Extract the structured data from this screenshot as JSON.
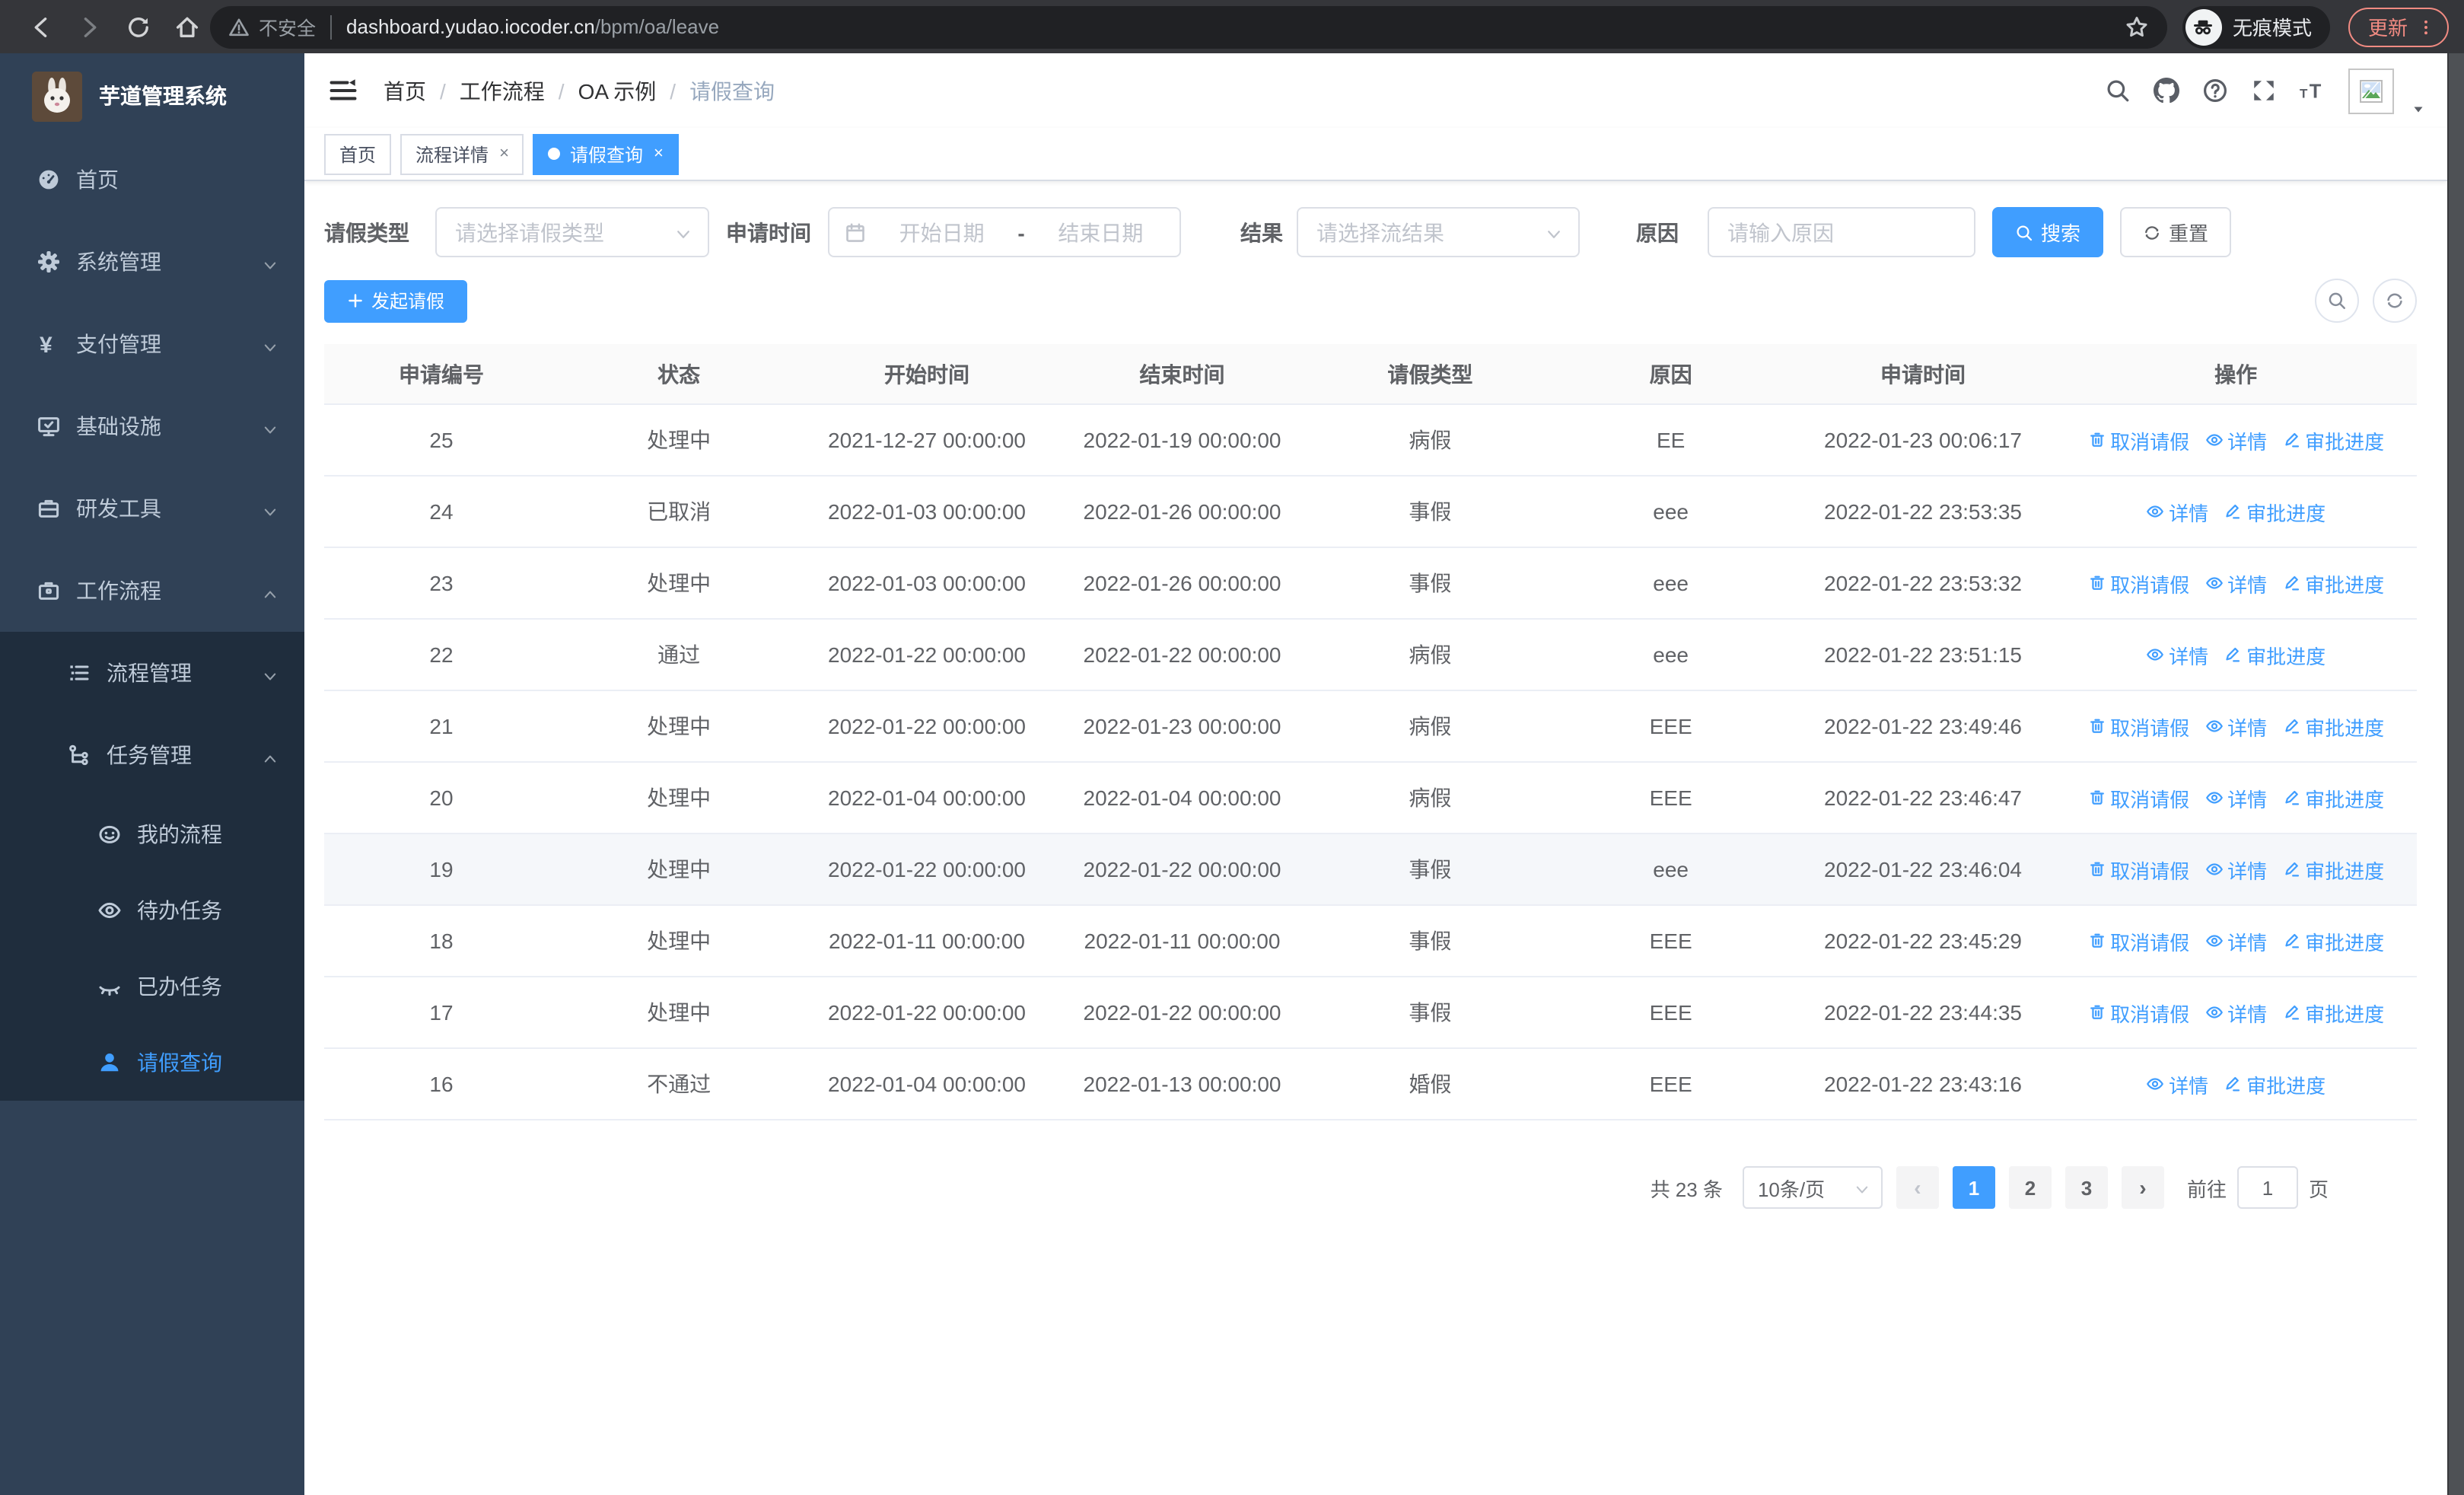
{
  "browser": {
    "security_label": "不安全",
    "url_host": "dashboard.yudao.iocoder.cn",
    "url_path": "/bpm/oa/leave",
    "incognito_label": "无痕模式",
    "update_label": "更新"
  },
  "colors": {
    "primary": "#409EFF",
    "sidebar_bg": "#304156",
    "submenu_bg": "#1f2d3d",
    "sidebar_text": "#bfcbd9",
    "update_accent": "#f28b82"
  },
  "sidebar": {
    "title": "芋道管理系统",
    "items": [
      {
        "label": "首页",
        "icon": "dashboard-icon",
        "level": 1
      },
      {
        "label": "系统管理",
        "icon": "gear-icon",
        "level": 1,
        "chevron": "down"
      },
      {
        "label": "支付管理",
        "icon": "yen-icon",
        "level": 1,
        "chevron": "down"
      },
      {
        "label": "基础设施",
        "icon": "monitor-icon",
        "level": 1,
        "chevron": "down"
      },
      {
        "label": "研发工具",
        "icon": "briefcase-icon",
        "level": 1,
        "chevron": "down"
      },
      {
        "label": "工作流程",
        "icon": "toolbox-icon",
        "level": 1,
        "chevron": "up"
      },
      {
        "label": "流程管理",
        "icon": "list-icon",
        "level": 2,
        "chevron": "down",
        "dark": true
      },
      {
        "label": "任务管理",
        "icon": "tree-icon",
        "level": 2,
        "chevron": "up",
        "dark": true
      },
      {
        "label": "我的流程",
        "icon": "robot-icon",
        "level": 3,
        "dark": true
      },
      {
        "label": "待办任务",
        "icon": "eye-icon",
        "level": 3,
        "dark": true
      },
      {
        "label": "已办任务",
        "icon": "eye-closed-icon",
        "level": 3,
        "dark": true
      },
      {
        "label": "请假查询",
        "icon": "user-icon",
        "level": 3,
        "dark": true,
        "active": true
      }
    ]
  },
  "header": {
    "breadcrumb": [
      "首页",
      "工作流程",
      "OA 示例",
      "请假查询"
    ]
  },
  "tabs": [
    {
      "label": "首页",
      "active": false,
      "closable": false
    },
    {
      "label": "流程详情",
      "active": false,
      "closable": true
    },
    {
      "label": "请假查询",
      "active": true,
      "closable": true
    }
  ],
  "filters": {
    "leave_type_label": "请假类型",
    "leave_type_placeholder": "请选择请假类型",
    "apply_time_label": "申请时间",
    "date_start_placeholder": "开始日期",
    "date_separator": "-",
    "date_end_placeholder": "结束日期",
    "result_label": "结果",
    "result_placeholder": "请选择流结果",
    "reason_label": "原因",
    "reason_placeholder": "请输入原因",
    "search_label": "搜索",
    "reset_label": "重置"
  },
  "toolbar": {
    "create_label": "发起请假"
  },
  "table": {
    "columns": [
      "申请编号",
      "状态",
      "开始时间",
      "结束时间",
      "请假类型",
      "原因",
      "申请时间",
      "操作"
    ],
    "col_widths": [
      11.2,
      11.5,
      12.2,
      12.2,
      11.5,
      11.5,
      12.6,
      17.3
    ],
    "action_labels": {
      "cancel": "取消请假",
      "detail": "详情",
      "progress": "审批进度"
    },
    "rows": [
      {
        "id": "25",
        "status": "处理中",
        "start": "2021-12-27 00:00:00",
        "end": "2022-01-19 00:00:00",
        "type": "病假",
        "reason": "EE",
        "apply_time": "2022-01-23 00:06:17",
        "actions": [
          "cancel",
          "detail",
          "progress"
        ]
      },
      {
        "id": "24",
        "status": "已取消",
        "start": "2022-01-03 00:00:00",
        "end": "2022-01-26 00:00:00",
        "type": "事假",
        "reason": "eee",
        "apply_time": "2022-01-22 23:53:35",
        "actions": [
          "detail",
          "progress"
        ]
      },
      {
        "id": "23",
        "status": "处理中",
        "start": "2022-01-03 00:00:00",
        "end": "2022-01-26 00:00:00",
        "type": "事假",
        "reason": "eee",
        "apply_time": "2022-01-22 23:53:32",
        "actions": [
          "cancel",
          "detail",
          "progress"
        ]
      },
      {
        "id": "22",
        "status": "通过",
        "start": "2022-01-22 00:00:00",
        "end": "2022-01-22 00:00:00",
        "type": "病假",
        "reason": "eee",
        "apply_time": "2022-01-22 23:51:15",
        "actions": [
          "detail",
          "progress"
        ]
      },
      {
        "id": "21",
        "status": "处理中",
        "start": "2022-01-22 00:00:00",
        "end": "2022-01-23 00:00:00",
        "type": "病假",
        "reason": "EEE",
        "apply_time": "2022-01-22 23:49:46",
        "actions": [
          "cancel",
          "detail",
          "progress"
        ]
      },
      {
        "id": "20",
        "status": "处理中",
        "start": "2022-01-04 00:00:00",
        "end": "2022-01-04 00:00:00",
        "type": "病假",
        "reason": "EEE",
        "apply_time": "2022-01-22 23:46:47",
        "actions": [
          "cancel",
          "detail",
          "progress"
        ]
      },
      {
        "id": "19",
        "status": "处理中",
        "start": "2022-01-22 00:00:00",
        "end": "2022-01-22 00:00:00",
        "type": "事假",
        "reason": "eee",
        "apply_time": "2022-01-22 23:46:04",
        "actions": [
          "cancel",
          "detail",
          "progress"
        ],
        "highlighted": true
      },
      {
        "id": "18",
        "status": "处理中",
        "start": "2022-01-11 00:00:00",
        "end": "2022-01-11 00:00:00",
        "type": "事假",
        "reason": "EEE",
        "apply_time": "2022-01-22 23:45:29",
        "actions": [
          "cancel",
          "detail",
          "progress"
        ]
      },
      {
        "id": "17",
        "status": "处理中",
        "start": "2022-01-22 00:00:00",
        "end": "2022-01-22 00:00:00",
        "type": "事假",
        "reason": "EEE",
        "apply_time": "2022-01-22 23:44:35",
        "actions": [
          "cancel",
          "detail",
          "progress"
        ]
      },
      {
        "id": "16",
        "status": "不通过",
        "start": "2022-01-04 00:00:00",
        "end": "2022-01-13 00:00:00",
        "type": "婚假",
        "reason": "EEE",
        "apply_time": "2022-01-22 23:43:16",
        "actions": [
          "detail",
          "progress"
        ]
      }
    ]
  },
  "pagination": {
    "total": "共 23 条",
    "page_size": "10条/页",
    "pages": [
      "1",
      "2",
      "3"
    ],
    "active_page": "1",
    "goto_label": "前往",
    "goto_value": "1",
    "page_suffix": "页"
  }
}
